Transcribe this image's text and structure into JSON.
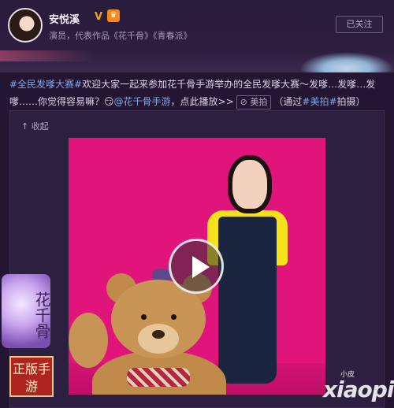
{
  "profile": {
    "username": "安悦溪",
    "verified_mark": "V",
    "badge_icon": "crown-icon",
    "bio": "演员，代表作品《花千骨》《青春派》",
    "follow_label": "已关注"
  },
  "post": {
    "hashtag": "#全民发嗲大赛#",
    "text1": "欢迎大家一起来参加花千骨手游举办的全民发嗲大赛～发嗲…发嗲…发嗲……你觉得容易嘛？",
    "emoji": "😏",
    "mention": "@花千骨手游",
    "text2": "，点此播放>>",
    "meipai_label": "美拍",
    "via_prefix": "（通过",
    "via_tag": "#美拍#",
    "via_suffix": "拍摄）"
  },
  "card": {
    "collapse_label": "收起"
  },
  "overlays": {
    "game_logo_text": "花千骨",
    "game_seal_text": "正版手游",
    "watermark_small": "小皮",
    "watermark_big": "xiaopi"
  }
}
